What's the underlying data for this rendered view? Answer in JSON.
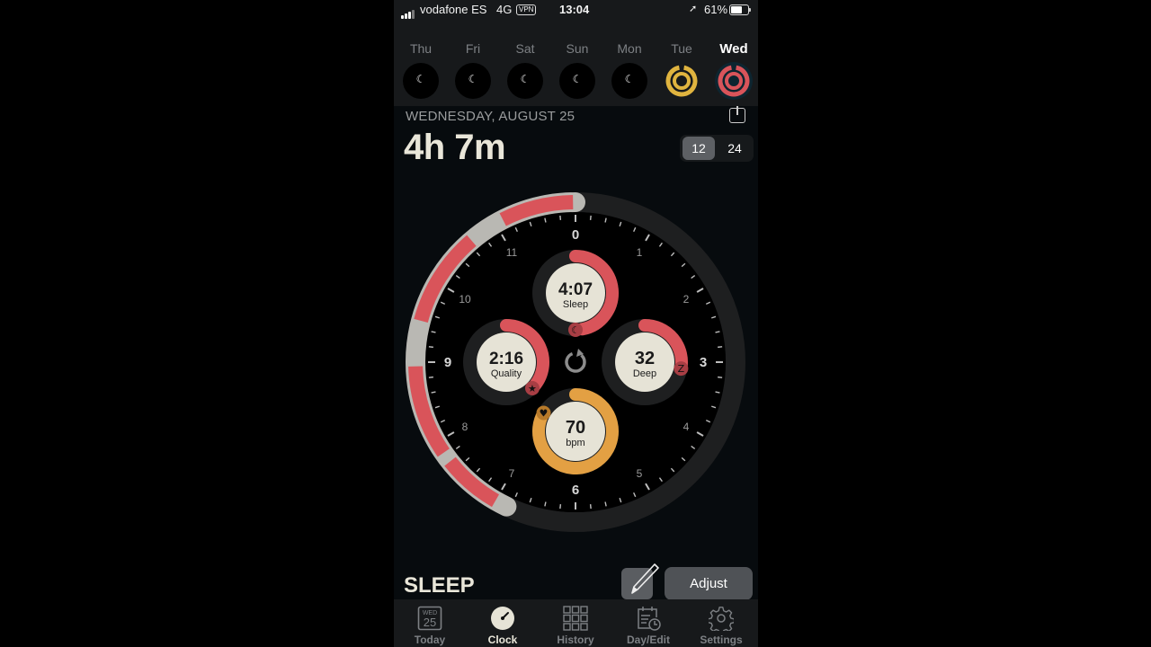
{
  "status_bar": {
    "carrier": "vodafone ES",
    "network": "4G",
    "vpn_label": "VPN",
    "time": "13:04",
    "battery_percent": "61%",
    "battery_level": 0.61
  },
  "week": {
    "days": [
      {
        "label": "Thu",
        "state": "empty"
      },
      {
        "label": "Fri",
        "state": "empty"
      },
      {
        "label": "Sat",
        "state": "empty"
      },
      {
        "label": "Sun",
        "state": "empty"
      },
      {
        "label": "Mon",
        "state": "empty"
      },
      {
        "label": "Tue",
        "state": "rings-yellow"
      },
      {
        "label": "Wed",
        "state": "rings-red",
        "active": true
      }
    ],
    "empty_icon": "moon-icon"
  },
  "header": {
    "date": "WEDNESDAY, AUGUST 25",
    "total_sleep": "4h 7m",
    "format_options": [
      "12",
      "24"
    ],
    "selected_format": "12"
  },
  "clock": {
    "hour_labels": [
      "0",
      "1",
      "2",
      "3",
      "4",
      "5",
      "6",
      "7",
      "8",
      "9",
      "10",
      "11"
    ],
    "sleep_start_hour": 6.85,
    "sleep_end_hour": 12.0,
    "segments": [
      {
        "from": 6.85,
        "to": 7.0,
        "type": "awake"
      },
      {
        "from": 7.0,
        "to": 7.72,
        "type": "asleep"
      },
      {
        "from": 7.72,
        "to": 7.85,
        "type": "awake"
      },
      {
        "from": 7.85,
        "to": 8.95,
        "type": "asleep"
      },
      {
        "from": 8.95,
        "to": 9.5,
        "type": "awake"
      },
      {
        "from": 9.5,
        "to": 10.65,
        "type": "asleep"
      },
      {
        "from": 10.65,
        "to": 11.1,
        "type": "awake"
      },
      {
        "from": 11.1,
        "to": 11.97,
        "type": "asleep"
      },
      {
        "from": 11.97,
        "to": 12.0,
        "type": "awake"
      }
    ],
    "center_icon": "refresh-icon",
    "gauges": [
      {
        "id": "sleep",
        "value": "4:07",
        "label": "Sleep",
        "progress": 0.47,
        "color": "#d9545a",
        "badge_icon": "moon-icon"
      },
      {
        "id": "quality",
        "value": "2:16",
        "label": "Quality",
        "progress": 0.36,
        "color": "#d9545a",
        "badge_icon": "star-icon"
      },
      {
        "id": "deep",
        "value": "32",
        "label": "Deep",
        "progress": 0.28,
        "color": "#d9545a",
        "badge_icon": "z-icon"
      },
      {
        "id": "bpm",
        "value": "70",
        "label": "bpm",
        "progress": 0.83,
        "color": "#e3a043",
        "badge_icon": "heart-icon"
      }
    ]
  },
  "footer": {
    "section_label": "SLEEP",
    "edit_icon": "pencil-icon",
    "adjust_label": "Adjust"
  },
  "tabbar": {
    "items": [
      {
        "label": "Today",
        "icon": "calendar-day-icon",
        "icon_day": "WED",
        "icon_date": "25"
      },
      {
        "label": "Clock",
        "icon": "clock-icon",
        "active": true
      },
      {
        "label": "History",
        "icon": "grid-icon"
      },
      {
        "label": "Day/Edit",
        "icon": "calendar-clock-icon"
      },
      {
        "label": "Settings",
        "icon": "gear-icon"
      }
    ]
  },
  "colors": {
    "asleep": "#d9545a",
    "awake": "#b9b8b3",
    "heart": "#e3a043",
    "tue_ring": "#e0b43f",
    "gauge_face": "#e6e3d6",
    "track": "#1e1f20"
  }
}
